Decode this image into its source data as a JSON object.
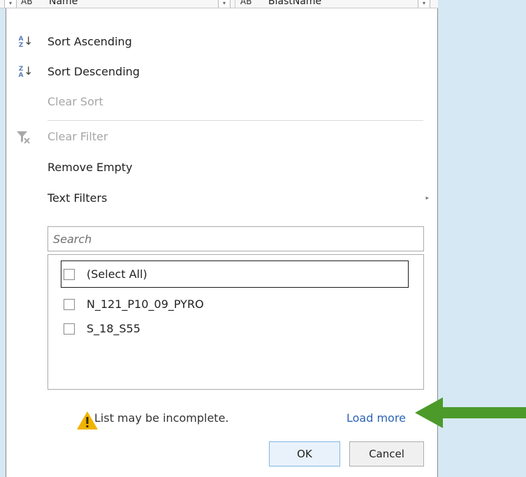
{
  "columns": [
    {
      "type_label": "AB",
      "name": "Name"
    },
    {
      "type_label": "AB",
      "name": "BlastName"
    }
  ],
  "menu": {
    "sort_ascending": "Sort Ascending",
    "sort_descending": "Sort Descending",
    "clear_sort": "Clear Sort",
    "clear_filter": "Clear Filter",
    "remove_empty": "Remove Empty",
    "text_filters": "Text Filters"
  },
  "icons": {
    "sort_asc_letters": "A Z",
    "sort_desc_letters": "Z A",
    "sort_arrow": "↓",
    "submenu_arrow": "▸",
    "dropdown": "▾"
  },
  "search": {
    "placeholder": "Search",
    "value": ""
  },
  "list": {
    "items": [
      {
        "label": "(Select All)",
        "checked": false
      },
      {
        "label": "N_121_P10_09_PYRO",
        "checked": false
      },
      {
        "label": "S_18_S55",
        "checked": false
      }
    ]
  },
  "footer": {
    "warning": "List may be incomplete.",
    "load_more": "Load more",
    "ok": "OK",
    "cancel": "Cancel"
  },
  "colors": {
    "background": "#d6e8f3",
    "link": "#2b63b7",
    "warning": "#f0b400",
    "arrow": "#4c9a2a"
  }
}
